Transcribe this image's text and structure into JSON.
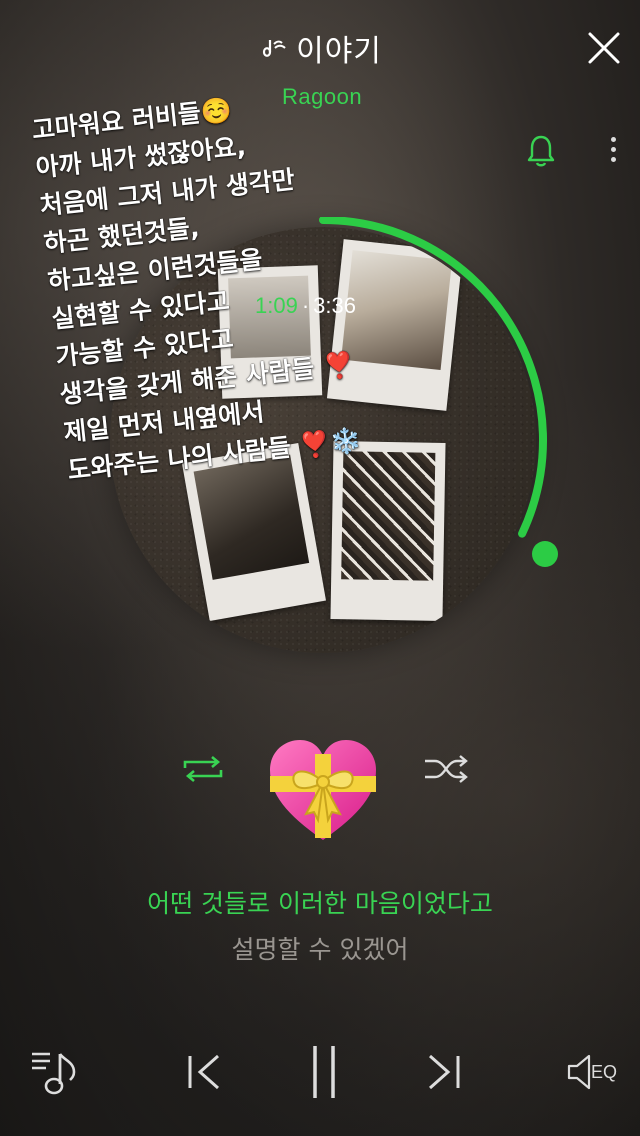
{
  "header": {
    "title": "이야기",
    "title_icon": "music-note-icon",
    "close_icon": "close-icon"
  },
  "track": {
    "artist": "Ragoon",
    "elapsed": "1:09",
    "separator": "·",
    "duration": "3:36",
    "progress": 0.32
  },
  "story_text": {
    "lines": [
      "고마워요 러비들☺️",
      "아까 내가 썼잖아요,",
      "처음에 그저 내가 생각만",
      "하곤 했던것들,",
      "하고싶은 이런것들을",
      "실현할 수 있다고",
      "가능할 수 있다고",
      "생각을 갖게 해준 사람들 ❣️",
      "제일 먼저 내옆에서",
      "도와주는 나의 사람들 ❣️❄️"
    ]
  },
  "controls": {
    "repeat_icon": "repeat-icon",
    "shuffle_icon": "shuffle-icon",
    "like_emoji": "💝",
    "notification_icon": "bell-icon",
    "more_icon": "more-vertical-icon"
  },
  "lyrics": {
    "current": "어떤 것들로 이러한 마음이었다고",
    "next": "설명할 수 있겠어"
  },
  "bottom_bar": {
    "playlist_icon": "playlist-music-icon",
    "prev_icon": "previous-track-icon",
    "pause_icon": "pause-icon",
    "next_icon": "next-track-icon",
    "eq_label": "EQ"
  },
  "colors": {
    "accent": "#39d353",
    "inactive_lyric": "#9a9691"
  }
}
